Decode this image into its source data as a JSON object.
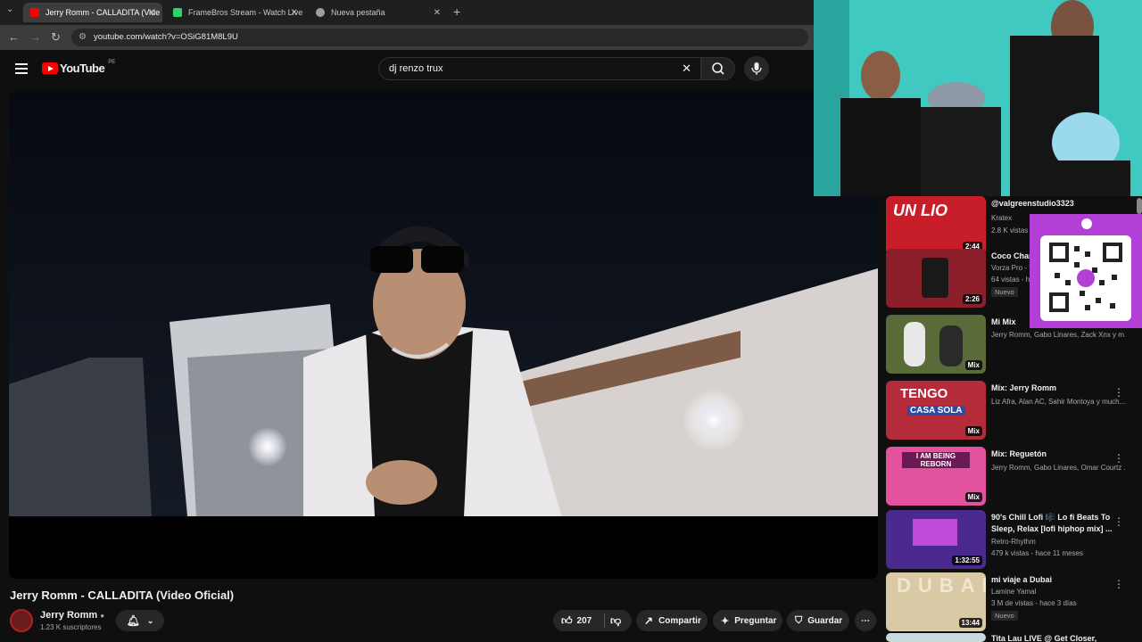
{
  "browser": {
    "tabs": [
      {
        "title": "Jerry Romm - CALLADITA (Vide",
        "active": true,
        "fav_color": "#ff0000"
      },
      {
        "title": "FrameBros Stream - Watch Live",
        "active": false,
        "fav_color": "#2fd36b"
      },
      {
        "title": "Nueva pestaña",
        "active": false,
        "fav_color": "#9aa0a6"
      }
    ],
    "new_tab": "+",
    "url": "youtube.com/watch?v=OSiG81M8L9U"
  },
  "youtube": {
    "logo_text": "YouTube",
    "country": "PE",
    "search_value": "dj renzo trux",
    "video_title": "Jerry Romm - CALLADITA (Video Oficial)",
    "channel": {
      "name": "Jerry Romm",
      "subscribers": "1.23 K suscriptores"
    },
    "actions": {
      "likes": "207",
      "share": "Compartir",
      "ask": "Preguntar",
      "save": "Guardar"
    }
  },
  "recommendations": [
    {
      "title": "@valgreenstudio3323",
      "channel": "Kratex",
      "meta": "2.8 K vistas",
      "duration": "2:44",
      "badge": ""
    },
    {
      "title": "Coco Char",
      "channel": "Vorza Pro - T",
      "meta": "64 vistas - h",
      "duration": "2:26",
      "badge": "Nuevo"
    },
    {
      "title": "Mi Mix",
      "channel": "Jerry Romm, Gabo Linares, Zack Xnx y m...",
      "meta": "",
      "duration": "Mix",
      "badge": ""
    },
    {
      "title": "Mix: Jerry Romm",
      "channel": "Liz Afra, Alan AC, Sahir Montoya y much...",
      "meta": "",
      "duration": "Mix",
      "badge": ""
    },
    {
      "title": "Mix: Reguetón",
      "channel": "Jerry Romm, Gabo Linares, Omar Courtz ...",
      "meta": "",
      "duration": "Mix",
      "badge": ""
    },
    {
      "title": "90's Chill Lofi 🎼 Lo fi Beats To Sleep, Relax [lofi hiphop mix] ...",
      "channel": "Retro-Rhythm",
      "meta": "479 k vistas - hace 11 meses",
      "duration": "1:32:55",
      "badge": ""
    },
    {
      "title": "mi viaje a Dubai",
      "channel": "Lamine Yamal",
      "meta": "3 M de vistas - hace 3 días",
      "duration": "13:44",
      "badge": "Nuevo"
    },
    {
      "title": "Tita Lau LIVE @ Get Closer,",
      "channel": "",
      "meta": "",
      "duration": "",
      "badge": ""
    }
  ],
  "overlay": {
    "thumb_texts": [
      "UN LIO",
      "TENGO",
      "CASA SOLA",
      "I AM BEING REBORN",
      "DUBAI"
    ]
  },
  "colors": {
    "yt_red": "#ff0000",
    "bg": "#0f0f0f",
    "qr_bg": "#b43fd6",
    "webcam_bg": "#3fc9c0"
  }
}
